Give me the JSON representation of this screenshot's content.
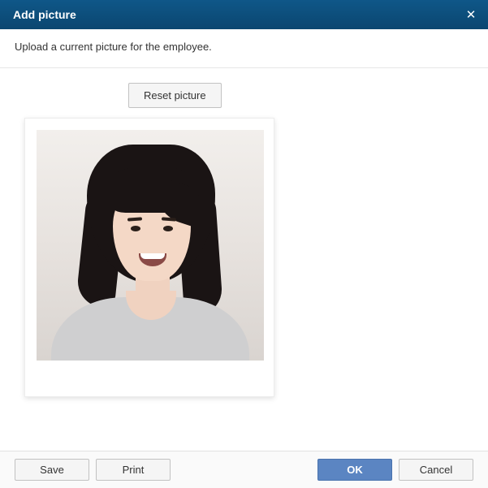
{
  "dialog": {
    "title": "Add picture",
    "close_icon": "✕",
    "instructions": "Upload a current picture for the employee."
  },
  "buttons": {
    "reset": "Reset picture",
    "save": "Save",
    "print": "Print",
    "ok": "OK",
    "cancel": "Cancel"
  },
  "picture": {
    "description": "Employee portrait photo"
  }
}
